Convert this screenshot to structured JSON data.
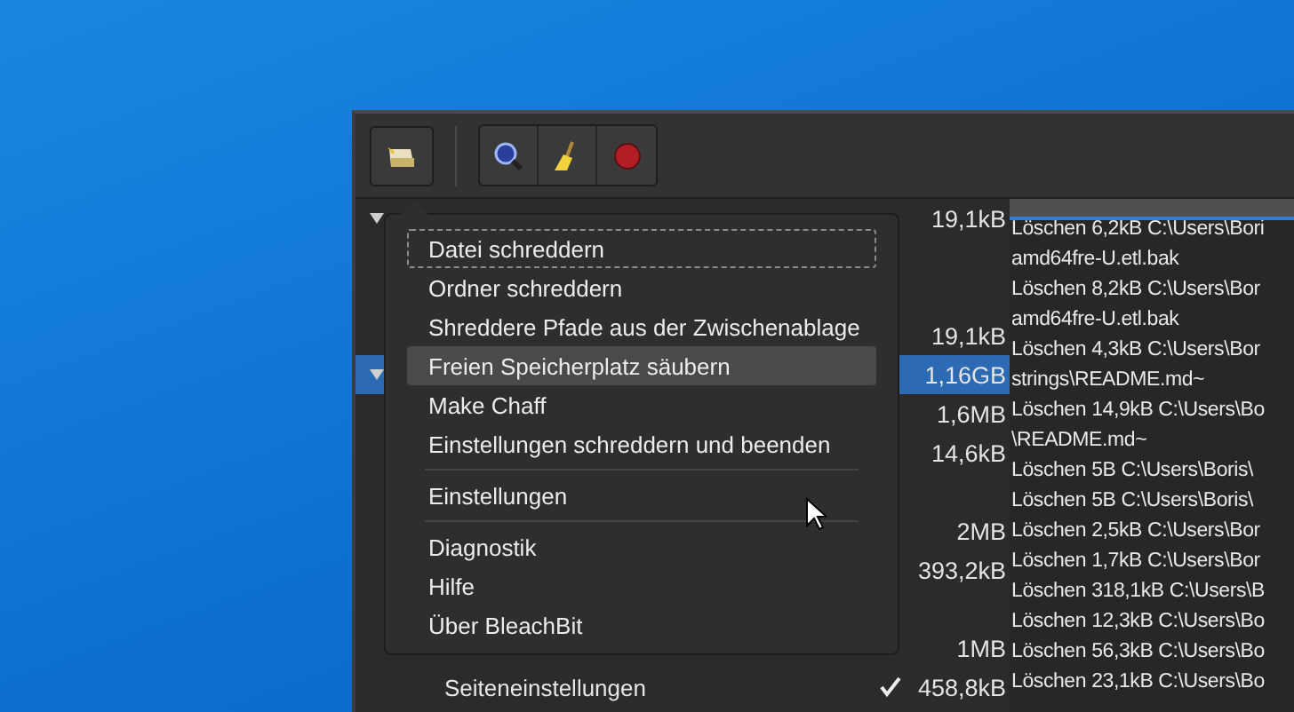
{
  "toolbar": {
    "buttons": [
      {
        "kind": "shred"
      },
      {
        "kind": "preview"
      },
      {
        "kind": "clean"
      },
      {
        "kind": "stop"
      }
    ]
  },
  "tree": {
    "rows": [
      {
        "kind": "category",
        "size": "19,1kB",
        "selected": false
      },
      {
        "kind": "option",
        "selected": false
      },
      {
        "kind": "option",
        "selected": false
      },
      {
        "kind": "option",
        "size": "19,1kB",
        "selected": false
      },
      {
        "kind": "category",
        "size": "1,16GB",
        "selected": true
      },
      {
        "kind": "option",
        "size": "1,6MB",
        "selected": false
      },
      {
        "kind": "option",
        "size": "14,6kB",
        "selected": false
      },
      {
        "kind": "option",
        "selected": false
      },
      {
        "kind": "option",
        "size": "2MB",
        "selected": false
      },
      {
        "kind": "option",
        "size": "393,2kB",
        "selected": false
      },
      {
        "kind": "option",
        "selected": false
      },
      {
        "kind": "option",
        "size": "1MB",
        "selected": false
      },
      {
        "kind": "option",
        "label": "Seiteneinstellungen",
        "checked": true,
        "size": "458,8kB",
        "selected": false
      }
    ]
  },
  "log": {
    "progress": {
      "level": 1
    },
    "lines": [
      "Löschen 6,2kB C:\\Users\\Bori",
      "amd64fre-U.etl.bak",
      "Löschen 8,2kB C:\\Users\\Bor",
      "amd64fre-U.etl.bak",
      "Löschen 4,3kB C:\\Users\\Bor",
      "strings\\README.md~",
      "Löschen 14,9kB C:\\Users\\Bo",
      "\\README.md~",
      "Löschen 5B C:\\Users\\Boris\\",
      "Löschen 5B C:\\Users\\Boris\\",
      "Löschen 2,5kB C:\\Users\\Bor",
      "Löschen 1,7kB C:\\Users\\Bor",
      "Löschen 318,1kB C:\\Users\\B",
      "Löschen 12,3kB C:\\Users\\Bo",
      "Löschen 56,3kB C:\\Users\\Bo",
      "Löschen 23,1kB C:\\Users\\Bo"
    ]
  },
  "menu": {
    "items": [
      {
        "kind": "item",
        "label": "Datei schreddern",
        "focused": true,
        "selected": false
      },
      {
        "kind": "item",
        "label": "Ordner schreddern",
        "focused": false,
        "selected": false
      },
      {
        "kind": "item",
        "label": "Shreddere Pfade aus der Zwischenablage",
        "focused": false,
        "selected": false
      },
      {
        "kind": "item",
        "label": "Freien Speicherplatz säubern",
        "focused": false,
        "selected": true
      },
      {
        "kind": "item",
        "label": "Make Chaff",
        "focused": false,
        "selected": false
      },
      {
        "kind": "item",
        "label": "Einstellungen schreddern und beenden",
        "focused": false,
        "selected": false
      },
      {
        "kind": "separator"
      },
      {
        "kind": "item",
        "label": "Einstellungen",
        "focused": false,
        "selected": false
      },
      {
        "kind": "separator"
      },
      {
        "kind": "item",
        "label": "Diagnostik",
        "focused": false,
        "selected": false
      },
      {
        "kind": "item",
        "label": "Hilfe",
        "focused": false,
        "selected": false
      },
      {
        "kind": "item",
        "label": "Über BleachBit",
        "focused": false,
        "selected": false
      }
    ]
  }
}
